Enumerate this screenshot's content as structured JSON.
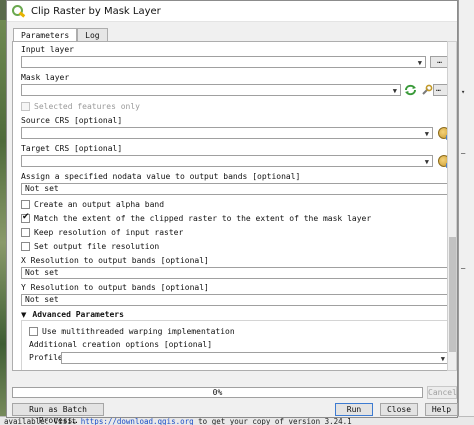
{
  "window": {
    "title": "Clip Raster by Mask Layer",
    "icon": "qgis-logo-icon"
  },
  "tabs": [
    {
      "label": "Parameters",
      "active": true
    },
    {
      "label": "Log",
      "active": false
    }
  ],
  "params": {
    "input_layer": {
      "label": "Input layer",
      "value": "",
      "browse": "…"
    },
    "mask_layer": {
      "label": "Mask layer",
      "value": "",
      "browse": "…"
    },
    "selected_only": {
      "label": "Selected features only",
      "checked": false,
      "enabled": false
    },
    "source_crs": {
      "label": "Source CRS [optional]",
      "value": ""
    },
    "target_crs": {
      "label": "Target CRS [optional]",
      "value": ""
    },
    "nodata": {
      "label": "Assign a specified nodata value to output bands [optional]",
      "value": "Not set"
    },
    "alpha_band": {
      "label": "Create an output alpha band",
      "checked": false
    },
    "match_extent": {
      "label": "Match the extent of the clipped raster to the extent of the mask layer",
      "checked": true
    },
    "keep_resolution": {
      "label": "Keep resolution of input raster",
      "checked": false
    },
    "set_resolution": {
      "label": "Set output file resolution",
      "checked": false
    },
    "x_resolution": {
      "label": "X Resolution to output bands [optional]",
      "value": "Not set"
    },
    "y_resolution": {
      "label": "Y Resolution to output bands [optional]",
      "value": "Not set"
    }
  },
  "advanced": {
    "header": "Advanced Parameters",
    "multithreaded": {
      "label": "Use multithreaded warping implementation",
      "checked": false
    },
    "creation_options": {
      "label": "Additional creation options [optional]"
    },
    "profile": {
      "label": "Profile",
      "value": ""
    }
  },
  "progress": {
    "text": "0%",
    "value": 0
  },
  "buttons": {
    "cancel": "Cancel",
    "batch": "Run as Batch Process…",
    "run": "Run",
    "close": "Close",
    "help": "Help"
  },
  "status_bar": {
    "prefix": "available: Visit",
    "link": "https://download.qgis.org",
    "suffix": "to get your copy of version 3.24.1"
  }
}
